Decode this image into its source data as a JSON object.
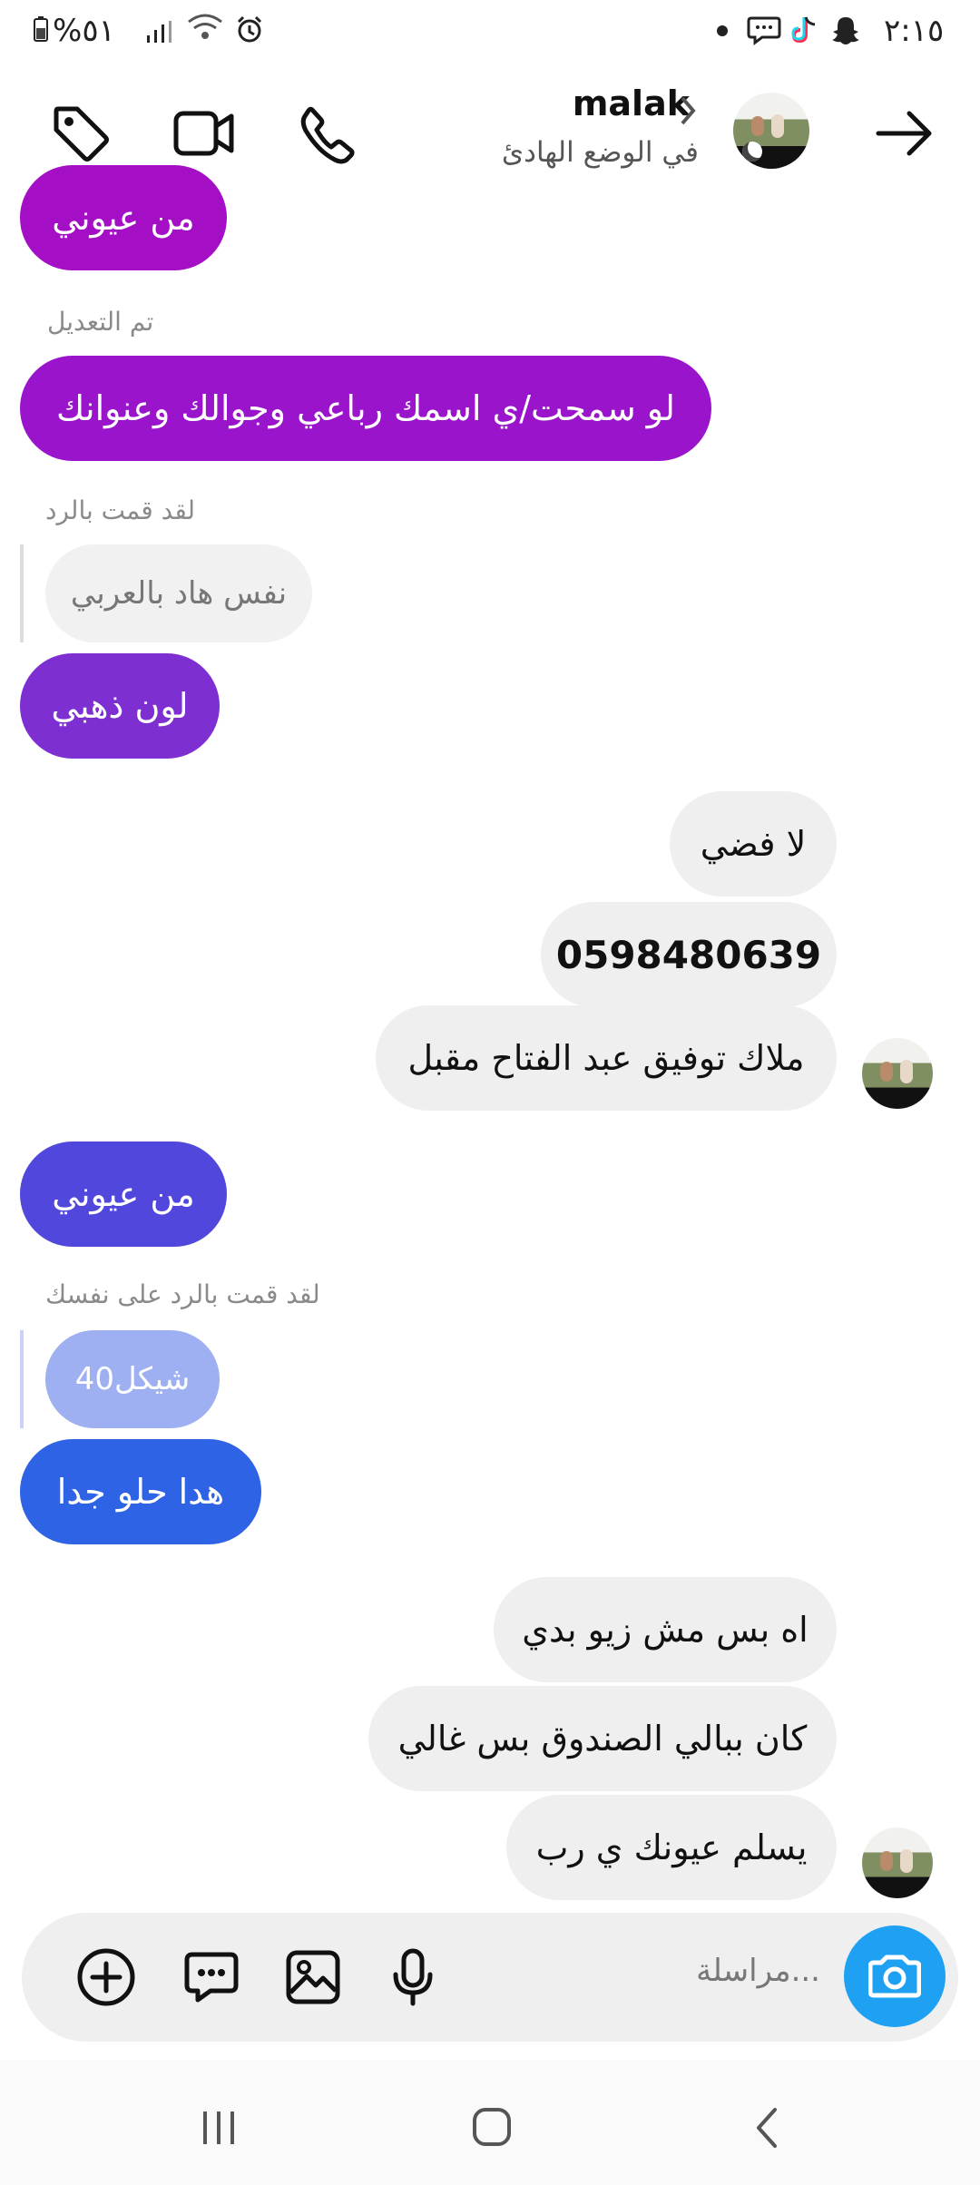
{
  "status_bar": {
    "time": "٢:١٥",
    "battery": "%٥١",
    "icons": [
      "battery-icon",
      "signal-icon",
      "wifi-icon",
      "alarm-icon",
      "dot-icon",
      "message-bubble-icon",
      "tiktok-icon",
      "snapchat-icon"
    ]
  },
  "header": {
    "name": "malak",
    "status": "في الوضع الهادئ",
    "icons": [
      "back-arrow-icon",
      "chevron-right-icon",
      "phone-icon",
      "video-icon",
      "tag-icon"
    ]
  },
  "messages": {
    "m1": "من عيوني",
    "edited_label": "تم التعديل",
    "m2": "لو سمحت/ي اسمك رباعي وجوالك وعنوانك",
    "reply_label_1": "لقد قمت بالرد",
    "quoted_1": "نفس هاد بالعربي",
    "m3": "لون ذهبي",
    "in_1": "لا فضي",
    "in_2": "0598480639",
    "in_3": "ملاك توفيق عبد الفتاح مقبل",
    "m4": "من عيوني",
    "reply_label_2": "لقد قمت بالرد على نفسك",
    "quoted_2": "40شيكل",
    "m5": "هدا حلو جدا",
    "in_4": "اه بس مش زيو بدي",
    "in_5": "كان ببالي الصندوق بس غالي",
    "in_6": "يسلم عيونك ي رب"
  },
  "composer": {
    "placeholder": "مراسلة..."
  },
  "colors": {
    "purple_1": "#a40fc6",
    "purple_2": "#9a14cc",
    "purple_3": "#7d2fd1",
    "indigo": "#5147dc",
    "blue": "#2f63e5",
    "quoted_blue": "#9eb0f1",
    "camera_blue": "#1ea1f2"
  }
}
